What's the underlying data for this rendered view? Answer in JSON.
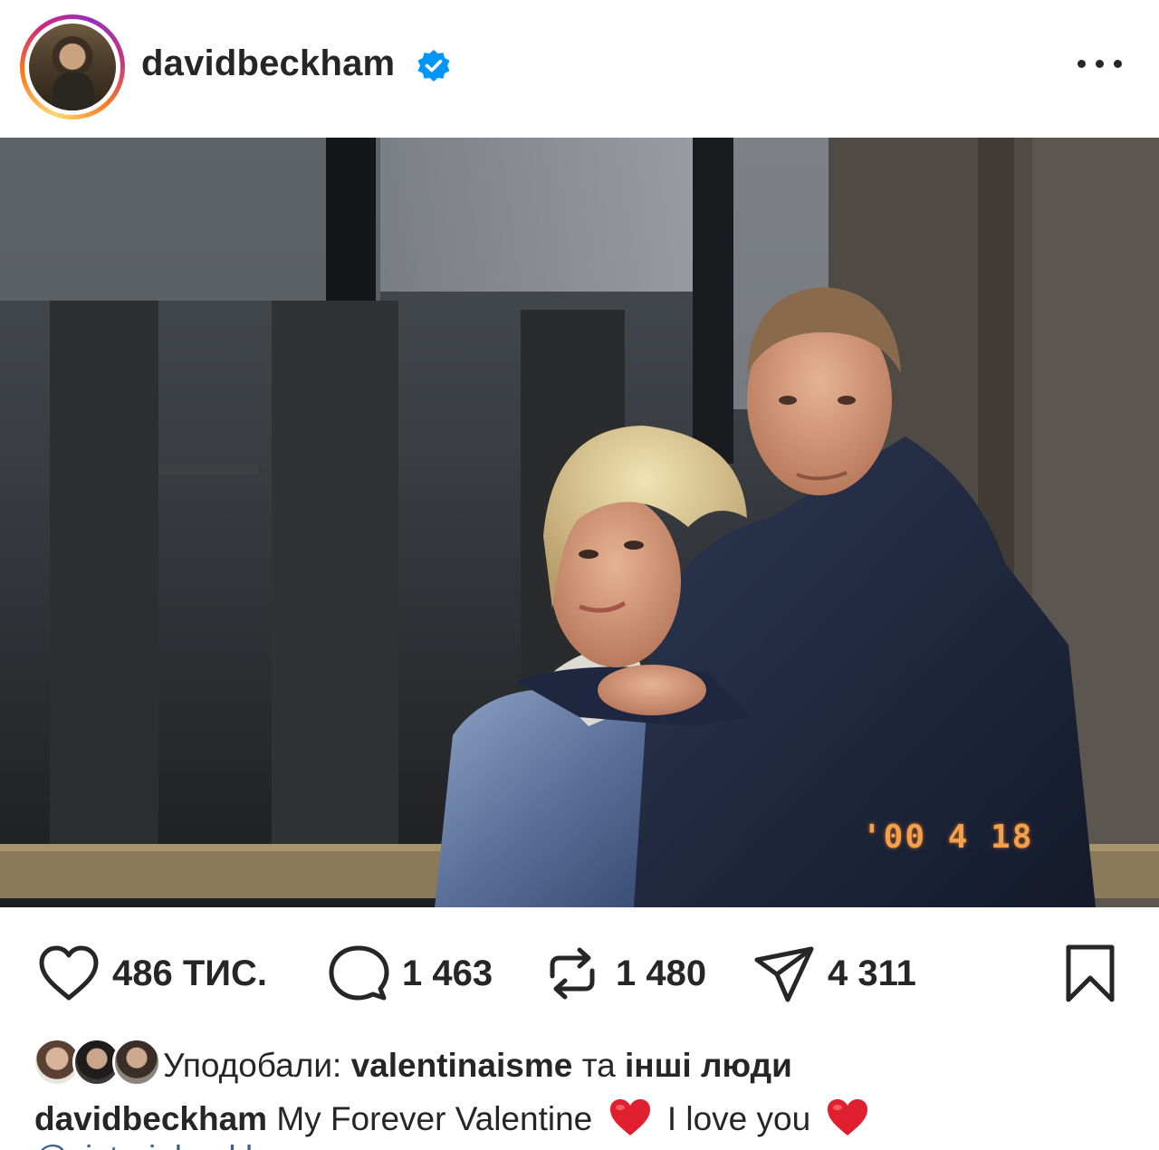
{
  "post": {
    "username": "davidbeckham",
    "verified": true,
    "avatar": "profile-photo",
    "more_icon": "more-options-icon",
    "photo": {
      "description_icon": "post-photo",
      "date_stamp": "'00  4 18"
    },
    "actions": {
      "likes_count": "486 ТИС.",
      "comments_count": "1 463",
      "reposts_count": "1 480",
      "shares_count": "4 311"
    },
    "likes_line": {
      "prefix": "Уподобали:",
      "user": "valentinaisme",
      "conjunction": "та",
      "others": "інші люди"
    },
    "caption": {
      "username": "davidbeckham",
      "text_part1": "My Forever Valentine",
      "text_part2": "I love you",
      "mention": "@victoriabeckham"
    }
  },
  "colors": {
    "text": "#262626",
    "verified_blue": "#0095f6",
    "heart_red": "#e0202e",
    "date_stamp": "#f5a04a",
    "mention": "#3d5f96"
  }
}
